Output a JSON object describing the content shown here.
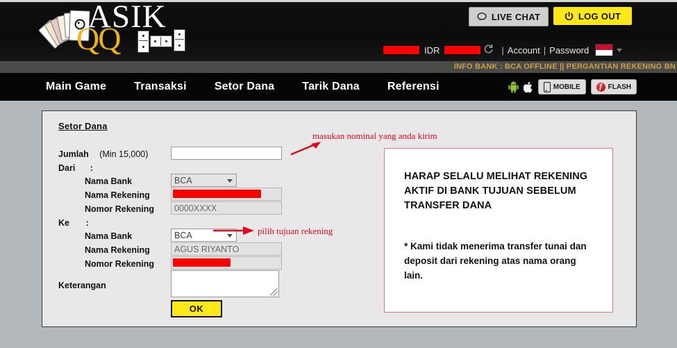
{
  "header": {
    "logo_text_top": "ASIK",
    "logo_text_bottom": "QQ",
    "live_chat_label": "LIVE CHAT",
    "log_out_label": "LOG OUT",
    "currency_label": "IDR",
    "username_redacted": "",
    "balance_redacted": "",
    "account_link": "Account",
    "password_link": "Password",
    "separator": "|",
    "language_flag": "indonesia-flag"
  },
  "ticker": {
    "text": "INFO BANK : BCA OFFLINE || PERGANTIAN REKENING BN"
  },
  "nav": {
    "items": [
      {
        "label": "Main Game"
      },
      {
        "label": "Transaksi"
      },
      {
        "label": "Setor Dana"
      },
      {
        "label": "Tarik Dana"
      },
      {
        "label": "Referensi"
      }
    ],
    "mobile_label": "MOBILE",
    "flash_label": "FLASH"
  },
  "form": {
    "title": "Setor Dana",
    "jumlah_label": "Jumlah",
    "jumlah_note": "(Min 15,000)",
    "jumlah_value": "",
    "dari_label": "Dari",
    "colon": ":",
    "ke_label": "Ke",
    "nama_bank_label": "Nama Bank",
    "nama_rekening_label": "Nama Rekening",
    "nomor_rekening_label": "Nomor Rekening",
    "keterangan_label": "Keterangan",
    "dari": {
      "nama_bank_value": "BCA",
      "nama_rekening_value": "",
      "nomor_rekening_value": "0000XXXX"
    },
    "ke": {
      "nama_bank_value": "BCA",
      "nama_rekening_value": "AGUS RIYANTO",
      "nomor_rekening_value": ""
    },
    "keterangan_value": "",
    "ok_label": "OK"
  },
  "annotations": {
    "jumlah_hint": "masukan nominal yang anda kirim",
    "bank_hint": "pilih tujuan rekening",
    "color": "#e2071b"
  },
  "notice": {
    "heading": "HARAP SELALU MELIHAT REKENING AKTIF DI BANK TUJUAN SEBELUM TRANSFER DANA",
    "body": "* Kami tidak menerima transfer tunai dan deposit dari rekening atas nama orang lain.",
    "border_color": "#e0768a"
  },
  "colors": {
    "accent_yellow": "#ffe817",
    "logo_gold": "#edb31e",
    "ticker_gold": "#cda043",
    "header_black": "#0a0a0a",
    "page_gray": "#b2b8bc",
    "panel_gray": "#e8e8e8",
    "redaction_red": "#fe0000"
  }
}
